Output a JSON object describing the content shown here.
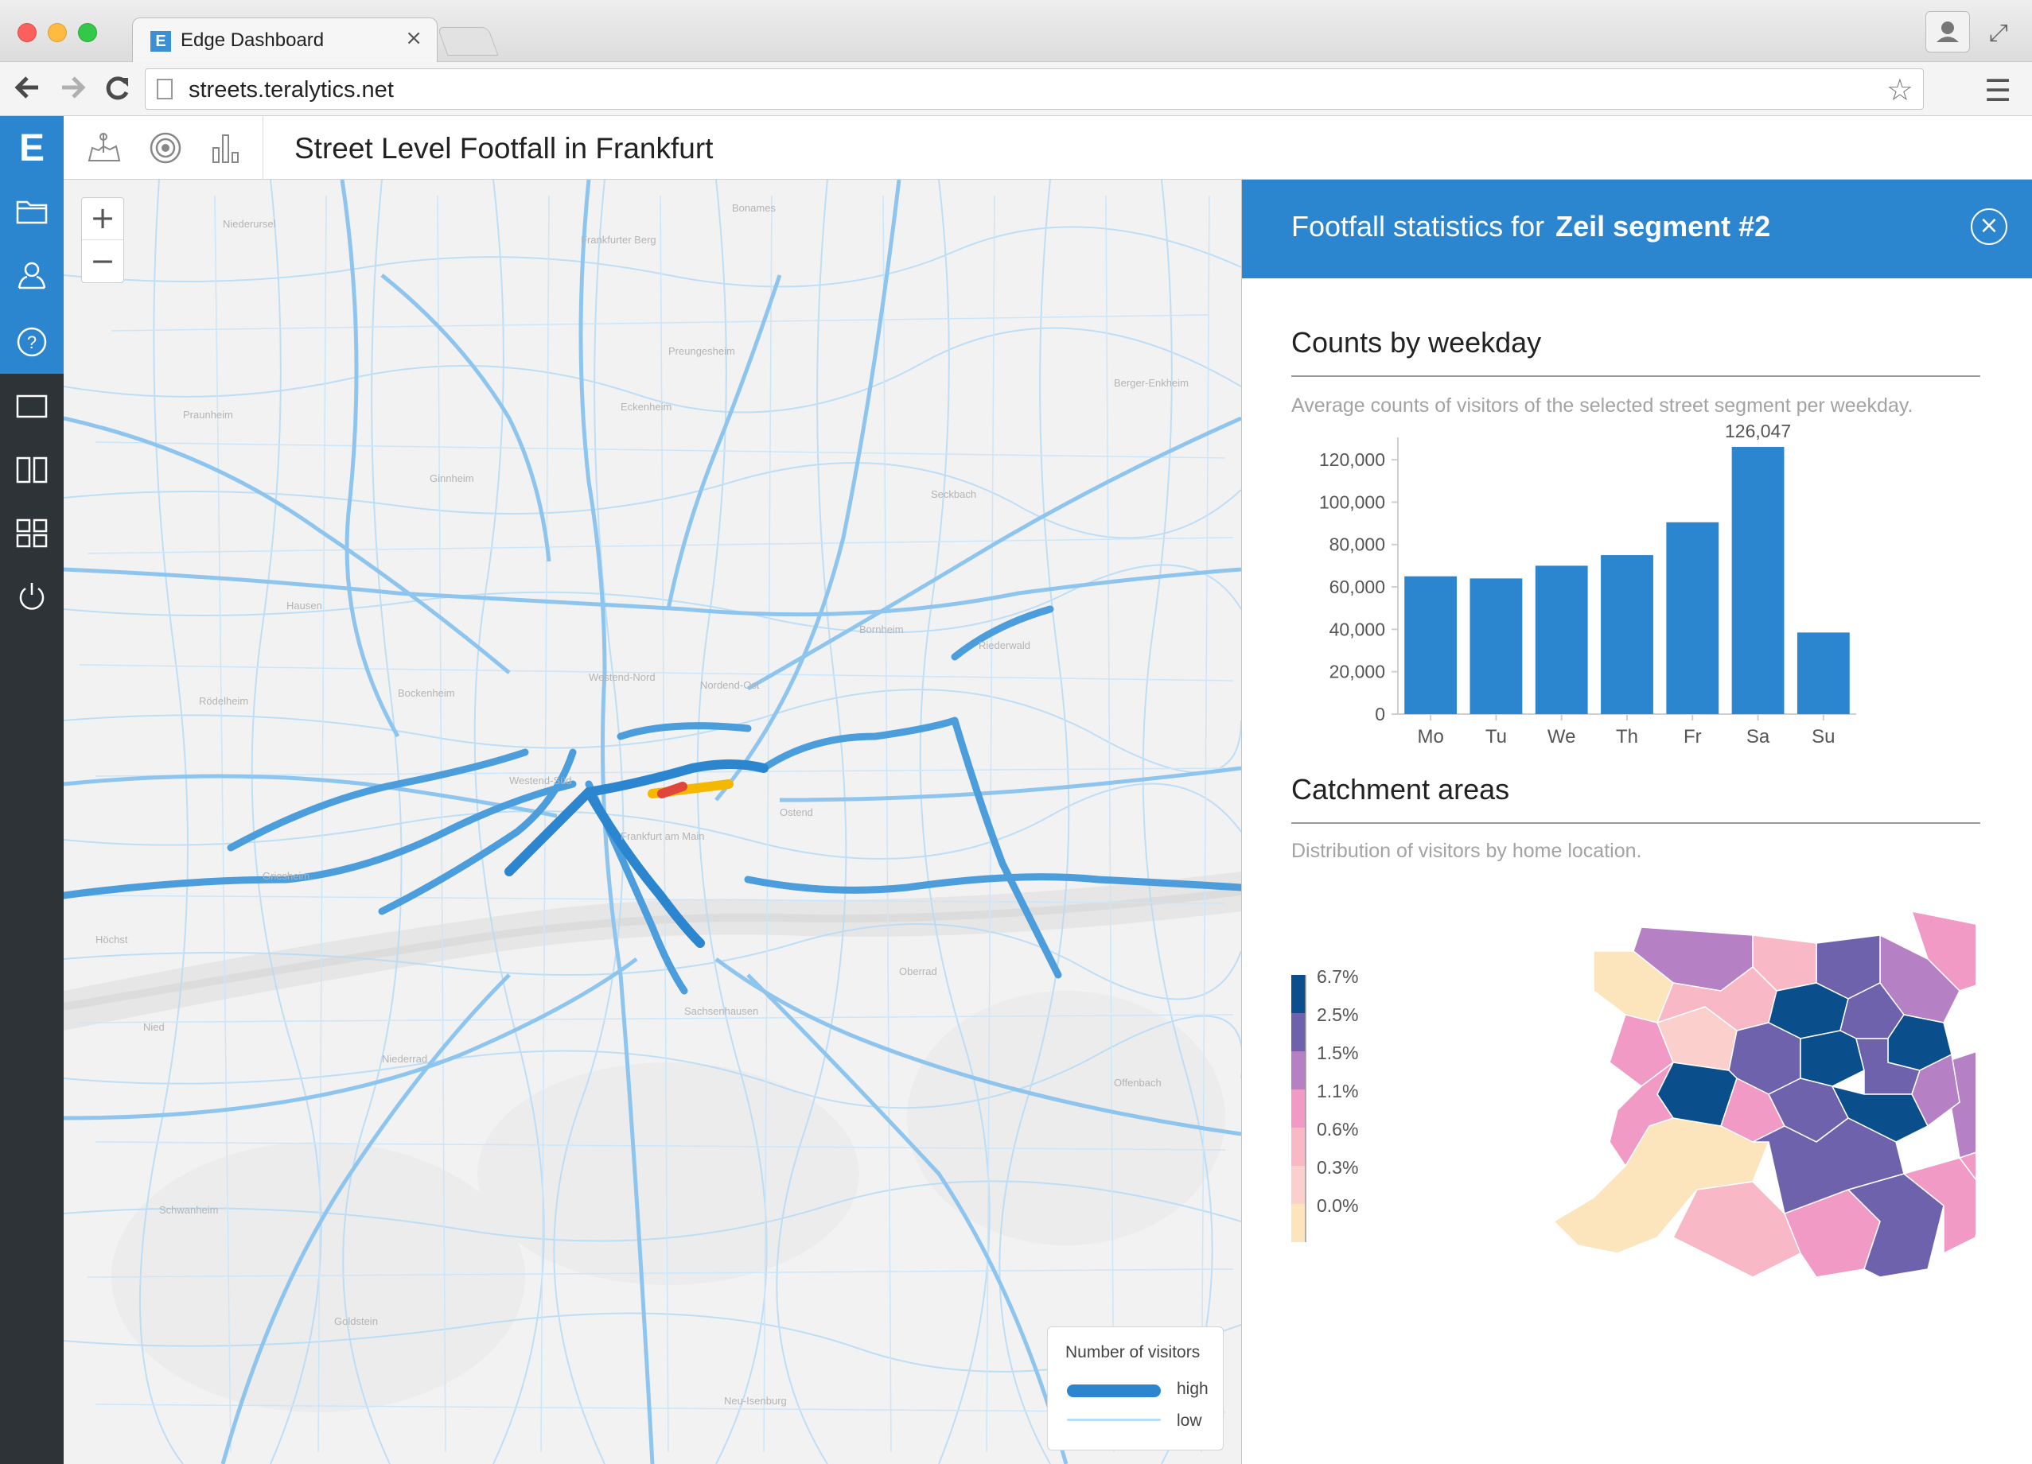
{
  "browser": {
    "tab_title": "Edge Dashboard",
    "tab_favicon": "E",
    "tab_close": "×",
    "url": "streets.teralytics.net",
    "back_icon": "arrow-left-icon",
    "forward_icon": "arrow-right-icon",
    "reload_icon": "reload-icon",
    "bookmark_icon": "star-icon",
    "menu_icon": "hamburger-icon",
    "profile_icon": "person-icon",
    "fullscreen_icon": "expand-icon"
  },
  "app": {
    "logo": "E",
    "title": "Street Level Footfall in Frankfurt",
    "accent": "#2c86cf",
    "sidebar_items": [
      "folder-icon",
      "user-icon",
      "help-icon",
      "single-panel-layout-icon",
      "two-panel-layout-icon",
      "grid-layout-icon",
      "power-icon"
    ],
    "tools": [
      "map-icon",
      "target-icon",
      "bar-chart-icon"
    ]
  },
  "map": {
    "zoom_in": "+",
    "zoom_out": "−",
    "legend": {
      "title": "Number of visitors",
      "high": "high",
      "low": "low"
    },
    "place_labels": [
      "Niederursel",
      "Frankfurter Berg",
      "Bonames",
      "Preungesheim",
      "Eckenheim",
      "Berger-Enkheim",
      "Praunheim",
      "Seckbach",
      "Ginnheim",
      "Hausen",
      "Westend-Nord",
      "Nordend-Ost",
      "Bornheim",
      "Riederwald",
      "Rödelheim",
      "Bockenheim",
      "Westend-Süd",
      "Ostend",
      "Frankfurt am Main",
      "Höchst",
      "Griesheim",
      "Nied",
      "Sachsenhausen",
      "Oberrad",
      "Niederrad",
      "Schwanheim",
      "Goldstein",
      "Neu-Isenburg",
      "Offenbach"
    ],
    "road_colors": {
      "low": "#b9dcf6",
      "mid": "#8ec5ee",
      "high": "#2c86cf",
      "selected_a": "#f5b800",
      "selected_b": "#e0463a"
    }
  },
  "panel": {
    "title_prefix": "Footfall statistics for",
    "title_segment": "Zeil segment #2",
    "close_icon": "close-circle-icon",
    "counts_title": "Counts by weekday",
    "counts_desc": "Average counts of visitors of the selected street segment per weekday.",
    "catchment_title": "Catchment areas",
    "catchment_desc": "Distribution of visitors by home location."
  },
  "chart_data": {
    "type": "bar",
    "categories": [
      "Mo",
      "Tu",
      "We",
      "Th",
      "Fr",
      "Sa",
      "Su"
    ],
    "values": [
      65000,
      64000,
      70000,
      75000,
      90500,
      126047,
      38500
    ],
    "data_labels": [
      null,
      null,
      null,
      null,
      null,
      "126,047",
      null
    ],
    "ylim": [
      0,
      126047
    ],
    "yticks": [
      0,
      20000,
      40000,
      60000,
      80000,
      100000,
      120000
    ],
    "ytick_labels": [
      "0",
      "20,000",
      "40,000",
      "60,000",
      "80,000",
      "100,000",
      "120,000"
    ],
    "bar_color": "#2c86cf",
    "title": "",
    "xlabel": "",
    "ylabel": ""
  },
  "catchment_legend": {
    "labels": [
      "6.7%",
      "2.5%",
      "1.5%",
      "1.1%",
      "0.6%",
      "0.3%",
      "0.0%"
    ],
    "colors": [
      "#0a4f8c",
      "#6f62ad",
      "#b580c4",
      "#f29ac6",
      "#f8b8c6",
      "#fbd0cc",
      "#fce4bd"
    ]
  }
}
